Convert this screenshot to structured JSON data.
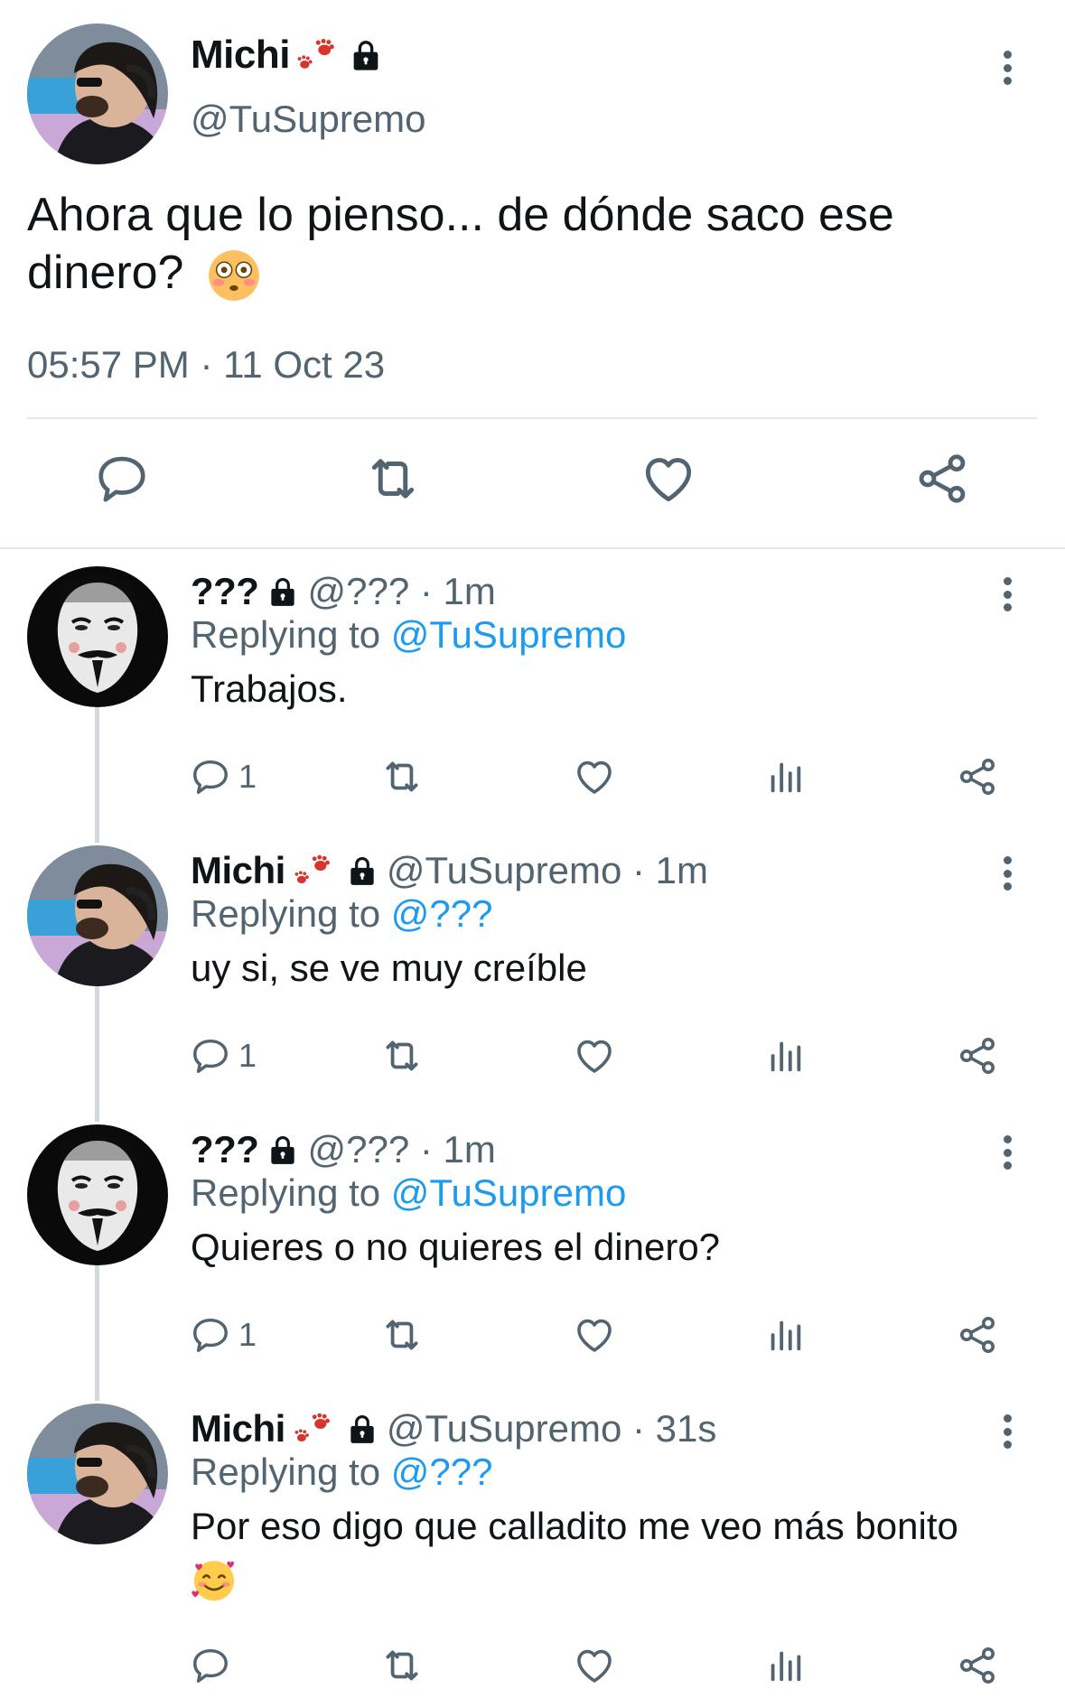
{
  "main_tweet": {
    "author_name": "Michi",
    "author_handle": "@TuSupremo",
    "text": "Ahora que lo pienso... de dónde saco ese dinero?",
    "emoji": "flushed-face",
    "timestamp": "05:57 PM · 11 Oct 23"
  },
  "replies": [
    {
      "author_name": "???",
      "handle_meta": "@??? · 1m",
      "replying_prefix": "Replying to ",
      "replying_to": "@TuSupremo",
      "text": "Trabajos.",
      "reply_count": "1",
      "avatar": "mask"
    },
    {
      "author_name": "Michi",
      "handle_meta": "@TuSupremo · 1m",
      "replying_prefix": "Replying to ",
      "replying_to": "@???",
      "text": "uy si, se ve muy creíble",
      "reply_count": "1",
      "avatar": "michi"
    },
    {
      "author_name": "???",
      "handle_meta": "@??? · 1m",
      "replying_prefix": "Replying to ",
      "replying_to": "@TuSupremo",
      "text": "Quieres o no quieres el dinero?",
      "reply_count": "1",
      "avatar": "mask"
    },
    {
      "author_name": "Michi",
      "handle_meta": "@TuSupremo · 31s",
      "replying_prefix": "Replying to ",
      "replying_to": "@???",
      "text": "Por eso digo que calladito me veo más bonito",
      "reply_count": "",
      "avatar": "michi",
      "emoji": "smiling-face-with-hearts"
    }
  ],
  "colors": {
    "text": "#0f1419",
    "secondary": "#536471",
    "accent": "#1d9bf0",
    "divider": "#e1e6ea"
  }
}
